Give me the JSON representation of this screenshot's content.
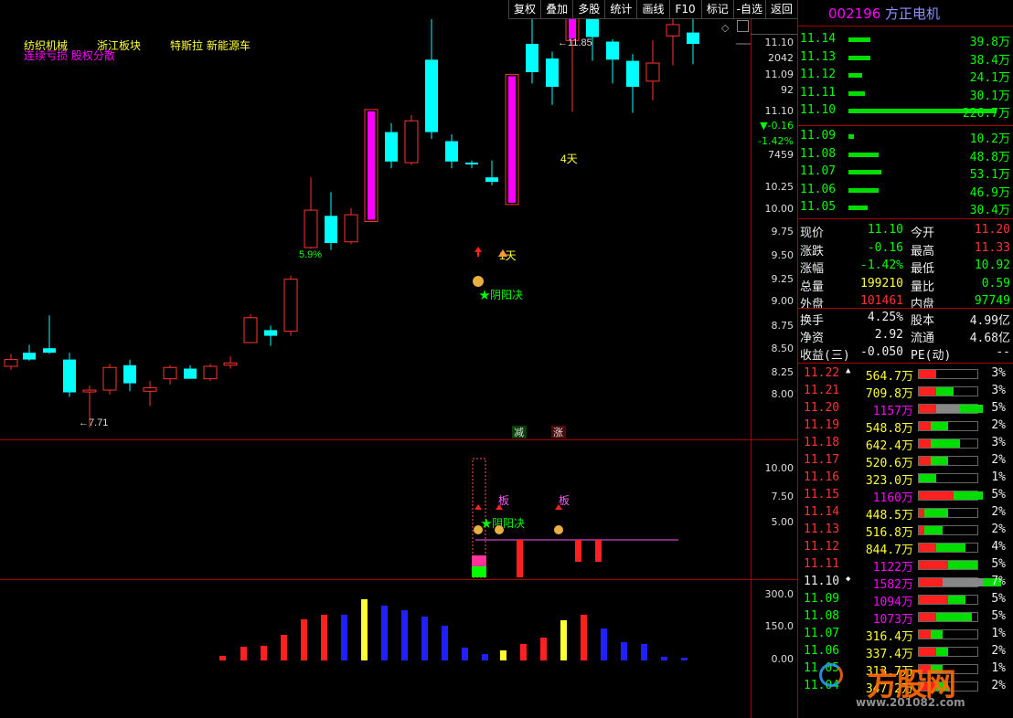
{
  "toolbar": [
    "复权",
    "叠加",
    "多股",
    "统计",
    "画线",
    "F10",
    "标记",
    "-自选",
    "返回"
  ],
  "chart": {
    "sector_labels": [
      "纺织机械",
      "浙江板块",
      "特斯拉 新能源车"
    ],
    "sub_label": "连续亏损 股权分散",
    "price_axis": [
      "11.10",
      "2042",
      "11.09",
      "92",
      "11.10",
      "▼-0.16",
      "-1.42%",
      "7459",
      "10.25",
      "10.00",
      "9.75",
      "9.50",
      "9.25",
      "9.00",
      "8.75",
      "8.50",
      "8.25",
      "8.00"
    ],
    "low_marker": "←7.71",
    "high_marker": "←11.85",
    "annot_4days": "4天",
    "annot_1day": "1天",
    "annot_yinyang": "★阴阳决",
    "annot_pct": "5.9%",
    "tag_reduce": "减",
    "tag_up": "涨",
    "mid_axis": [
      "10.00",
      "7.50",
      "5.00"
    ],
    "mid_ban": "板",
    "mid_yinyang": "★阴阳决",
    "vol_axis": [
      "300.0",
      "150.0",
      "0.00"
    ]
  },
  "stock": {
    "code": "002196",
    "name": "方正电机"
  },
  "sell_book": [
    {
      "price": "11.14",
      "vol": "39.8万",
      "bar": 0.08
    },
    {
      "price": "11.13",
      "vol": "38.4万",
      "bar": 0.08
    },
    {
      "price": "11.12",
      "vol": "24.1万",
      "bar": 0.05
    },
    {
      "price": "11.11",
      "vol": "30.1万",
      "bar": 0.06
    },
    {
      "price": "11.10",
      "vol": "226.7万",
      "bar": 0.54
    }
  ],
  "buy_book": [
    {
      "price": "11.09",
      "vol": "10.2万",
      "bar": 0.02
    },
    {
      "price": "11.08",
      "vol": "48.8万",
      "bar": 0.11
    },
    {
      "price": "11.07",
      "vol": "53.1万",
      "bar": 0.12
    },
    {
      "price": "11.06",
      "vol": "46.9万",
      "bar": 0.11
    },
    {
      "price": "11.05",
      "vol": "30.4万",
      "bar": 0.07
    }
  ],
  "quote": [
    {
      "l1": "现价",
      "v1": "11.10",
      "c1": "green",
      "l2": "今开",
      "v2": "11.20",
      "c2": "red"
    },
    {
      "l1": "涨跌",
      "v1": "-0.16",
      "c1": "green",
      "l2": "最高",
      "v2": "11.33",
      "c2": "red"
    },
    {
      "l1": "涨幅",
      "v1": "-1.42%",
      "c1": "green",
      "l2": "最低",
      "v2": "10.92",
      "c2": "green"
    },
    {
      "l1": "总量",
      "v1": "199210",
      "c1": "yellow",
      "l2": "量比",
      "v2": "0.59",
      "c2": "green"
    },
    {
      "l1": "外盘",
      "v1": "101461",
      "c1": "red",
      "l2": "内盘",
      "v2": "97749",
      "c2": "green"
    }
  ],
  "fundamentals": [
    {
      "l1": "换手",
      "v1": "4.25%",
      "l2": "股本",
      "v2": "4.99亿"
    },
    {
      "l1": "净资",
      "v1": "2.92",
      "l2": "流通",
      "v2": "4.68亿"
    },
    {
      "l1": "收益(三)",
      "v1": "-0.050",
      "l2": "PE(动)",
      "v2": "--"
    }
  ],
  "price_dist": [
    {
      "price": "11.22",
      "vol": "564.7万",
      "pct": "3%",
      "r": 0.3,
      "g": 0.0,
      "gr": 0,
      "mark": "▲"
    },
    {
      "price": "11.21",
      "vol": "709.8万",
      "pct": "3%",
      "r": 0.3,
      "g": 0.3,
      "gr": 0
    },
    {
      "price": "11.20",
      "vol": "1157万",
      "pct": "5%",
      "r": 0.3,
      "g": 0.4,
      "gr": 0.4,
      "vc": "magenta"
    },
    {
      "price": "11.19",
      "vol": "548.8万",
      "pct": "2%",
      "r": 0.2,
      "g": 0.3,
      "gr": 0
    },
    {
      "price": "11.18",
      "vol": "642.4万",
      "pct": "3%",
      "r": 0.2,
      "g": 0.5,
      "gr": 0
    },
    {
      "price": "11.17",
      "vol": "520.6万",
      "pct": "2%",
      "r": 0.2,
      "g": 0.3,
      "gr": 0
    },
    {
      "price": "11.16",
      "vol": "323.0万",
      "pct": "1%",
      "r": 0,
      "g": 0.3,
      "gr": 0
    },
    {
      "price": "11.15",
      "vol": "1160万",
      "pct": "5%",
      "r": 0.6,
      "g": 0.5,
      "gr": 0,
      "vc": "magenta"
    },
    {
      "price": "11.14",
      "vol": "448.5万",
      "pct": "2%",
      "r": 0.1,
      "g": 0.4,
      "gr": 0
    },
    {
      "price": "11.13",
      "vol": "516.8万",
      "pct": "2%",
      "r": 0.1,
      "g": 0.3,
      "gr": 0
    },
    {
      "price": "11.12",
      "vol": "844.7万",
      "pct": "4%",
      "r": 0.3,
      "g": 0.5,
      "gr": 0
    },
    {
      "price": "11.11",
      "vol": "1122万",
      "pct": "5%",
      "r": 0.5,
      "g": 0.5,
      "gr": 0,
      "vc": "magenta"
    },
    {
      "price": "11.10",
      "vol": "1582万",
      "pct": "7%",
      "r": 0.4,
      "g": 0.3,
      "gr": 0.7,
      "vc": "magenta",
      "mark": "◆"
    },
    {
      "price": "11.09",
      "vol": "1094万",
      "pct": "5%",
      "r": 0.5,
      "g": 0.3,
      "gr": 0,
      "vc": "magenta"
    },
    {
      "price": "11.08",
      "vol": "1073万",
      "pct": "5%",
      "r": 0.3,
      "g": 0.6,
      "gr": 0,
      "vc": "magenta"
    },
    {
      "price": "11.07",
      "vol": "316.4万",
      "pct": "1%",
      "r": 0.2,
      "g": 0.2,
      "gr": 0
    },
    {
      "price": "11.06",
      "vol": "337.4万",
      "pct": "2%",
      "r": 0.3,
      "g": 0.2,
      "gr": 0
    },
    {
      "price": "11.05",
      "vol": "313.7万",
      "pct": "1%",
      "r": 0.2,
      "g": 0.2,
      "gr": 0
    },
    {
      "price": "11.04",
      "vol": "347.2万",
      "pct": "2%",
      "r": 0.3,
      "g": 0.2,
      "gr": 0
    }
  ],
  "watermark": {
    "text": "方股网",
    "url": "www.201082.com"
  }
}
